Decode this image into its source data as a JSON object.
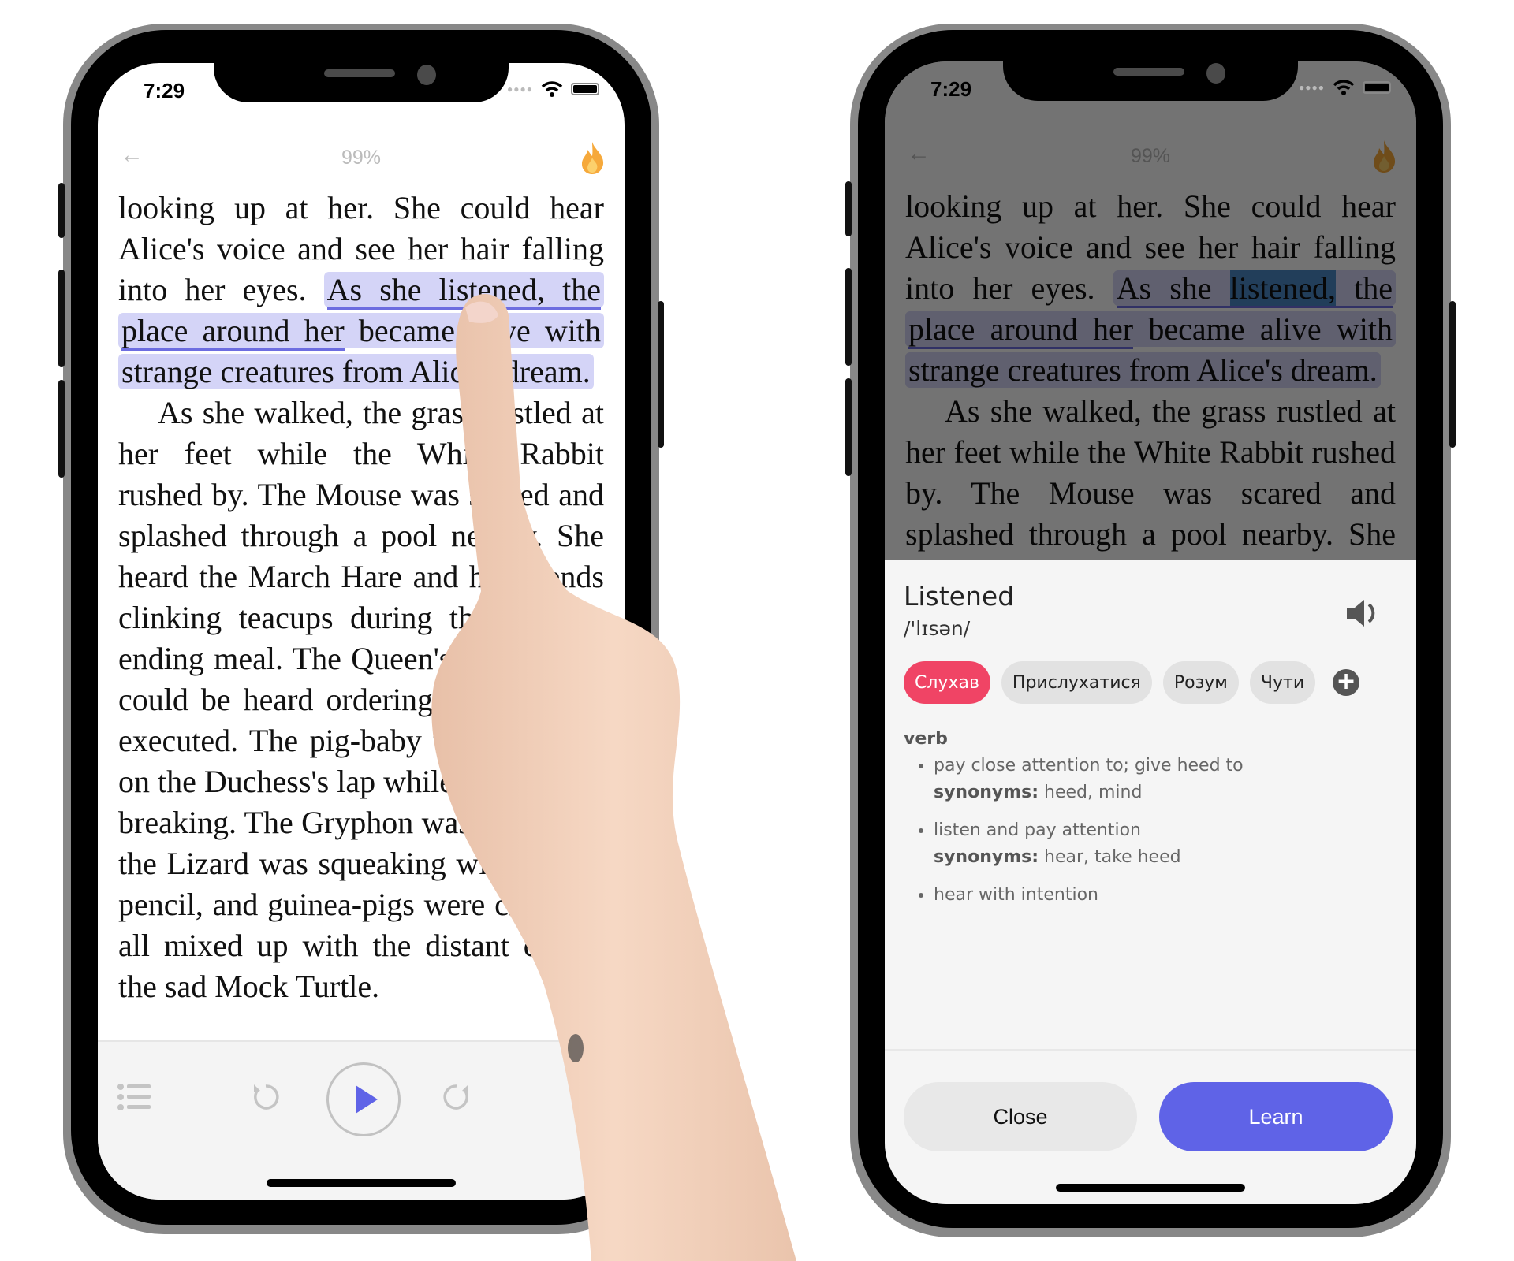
{
  "status_bar": {
    "time": "7:29"
  },
  "reader": {
    "progress": "99%",
    "back_icon": "arrow-left-icon",
    "streak_icon": "flame-icon",
    "paragraph1": {
      "before": "looking up at her.  She could hear Alice's voice and see her hair falling into her eyes. ",
      "hl_a": "As she ",
      "selected_word": "listened,",
      "hl_b": " the place around her",
      "hl_c": " became alive with strange creatures from Alice's dream."
    },
    "paragraph2": "As she walked, the grass rustled at her feet while the White Rabbit rushed by.  The Mouse was scared and splashed through a pool nearby.  She heard the March Hare and his friends clinking teacups during their never-ending meal.  The Queen's shrill voice could be heard ordering guests to be executed.  The pig-baby was sneezing on the Duchess's lap while plates were breaking.  The Gryphon was shrieking, the Lizard was squeaking with a slate pencil, and guinea-pigs were choking, all mixed up with the distant cry of the sad Mock Turtle.",
    "player": {
      "toc_icon": "list-icon",
      "rewind_icon": "rewind-icon",
      "play_icon": "play-icon",
      "forward_icon": "forward-icon"
    }
  },
  "dictionary": {
    "word": "Listened",
    "phonetic": "/'lɪsən/",
    "audio_icon": "speaker-icon",
    "translations": [
      {
        "label": "Слухав",
        "active": true
      },
      {
        "label": "Прислухатися",
        "active": false
      },
      {
        "label": "Розум",
        "active": false
      },
      {
        "label": "Чути",
        "active": false
      }
    ],
    "add_icon": "plus-icon",
    "part_of_speech": "verb",
    "definitions": [
      {
        "text": "pay close attention to; give heed to",
        "synonyms_label": "synonyms:",
        "synonyms": "heed, mind"
      },
      {
        "text": "listen and pay attention",
        "synonyms_label": "synonyms:",
        "synonyms": "hear, take heed"
      },
      {
        "text": "hear with intention"
      }
    ],
    "close_label": "Close",
    "learn_label": "Learn"
  },
  "colors": {
    "accent": "#5f63e7",
    "active_chip": "#f04465",
    "highlight": "#d4d4f7",
    "flame": "#f6a93b"
  }
}
